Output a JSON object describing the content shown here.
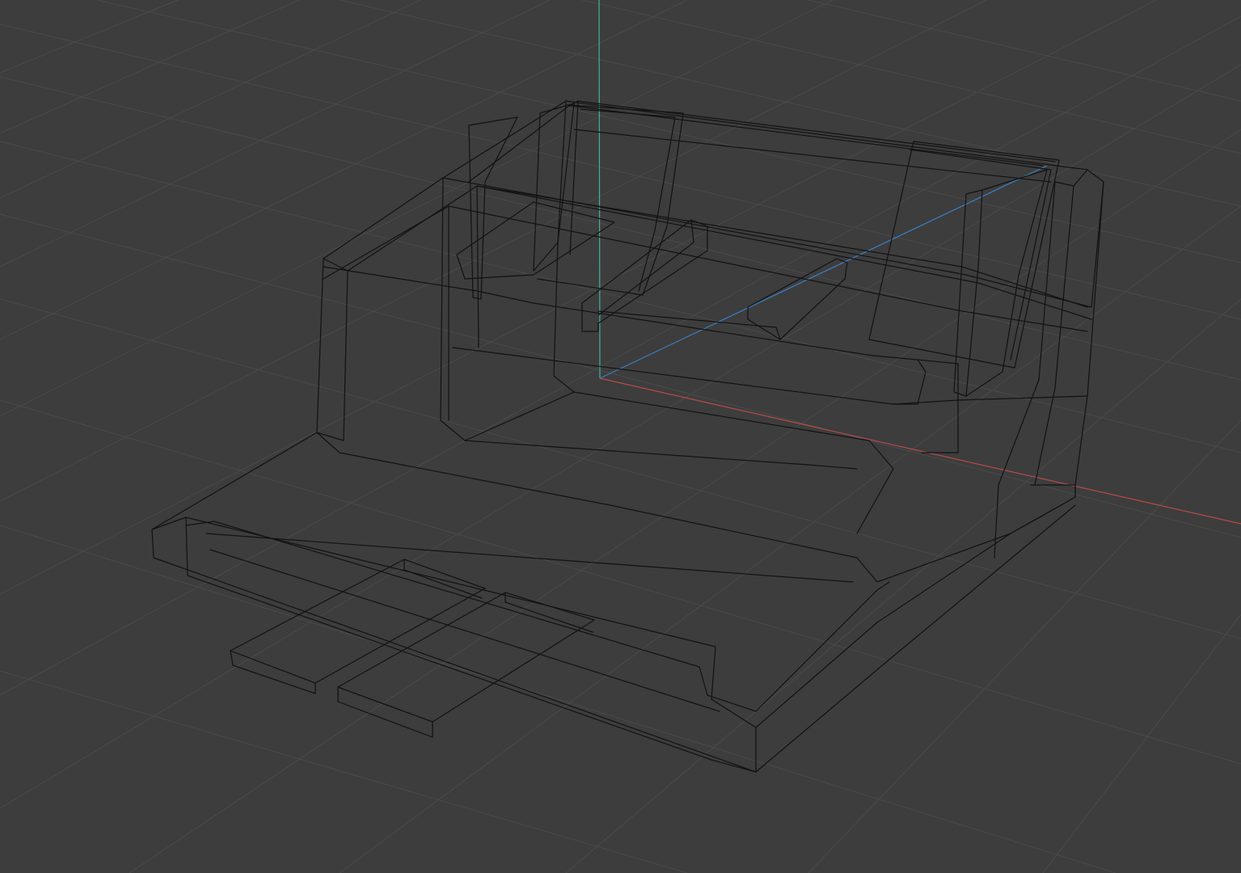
{
  "viewport": {
    "mode": "wireframe",
    "background_color": "#3d3d3d",
    "grid_color": "#4a4a4a",
    "wire_color": "#121212",
    "axis_colors": {
      "x": "#b84a4a",
      "y": "#3fb29a",
      "z": "#3a7fc4"
    }
  }
}
